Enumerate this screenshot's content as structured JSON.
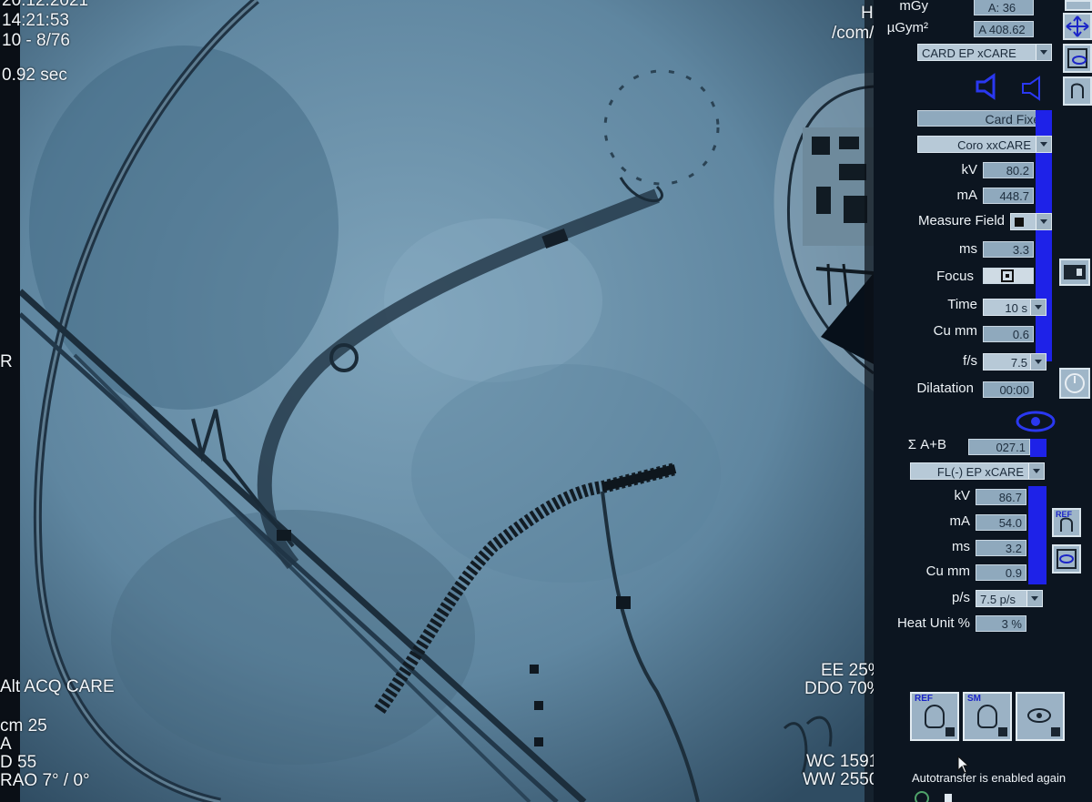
{
  "overlay": {
    "top_left": [
      "20.12.2021",
      "14:21:53",
      "10 - 8/76",
      "0.92 sec"
    ],
    "left_marker": "R",
    "bottom_left": [
      "Alt ACQ CARE",
      "cm 25",
      "A",
      "D 55",
      "RAO 7° / 0°"
    ],
    "top_right": [
      "HFS",
      "/com/////"
    ],
    "bottom_right_ee": [
      "EE 25%",
      "DDO 70%"
    ],
    "bottom_right_wc": [
      "WC 1591",
      "WW 2550"
    ]
  },
  "panel": {
    "dose": [
      {
        "label": "mGy",
        "value": "A: 36"
      },
      {
        "label": "µGym²",
        "value": "A 408.62"
      }
    ],
    "program_select": "CARD EP xCARE",
    "acquisition": {
      "mode": "Card Fixed",
      "protocol_select": "Coro xxCARE",
      "rows": [
        {
          "label": "kV",
          "value": "80.2"
        },
        {
          "label": "mA",
          "value": "448.7"
        }
      ],
      "measure_field_label": "Measure Field",
      "ms": {
        "label": "ms",
        "value": "3.3"
      },
      "focus_label": "Focus",
      "time": {
        "label": "Time",
        "value": "10 s"
      },
      "cu": {
        "label": "Cu mm",
        "value": "0.6"
      },
      "fs": {
        "label": "f/s",
        "value": "7.5"
      },
      "dilatation": {
        "label": "Dilatation",
        "value": "00:00"
      }
    },
    "fluoro": {
      "sum": {
        "label": "Σ  A+B",
        "value": "027.1"
      },
      "protocol_select": "FL(-) EP xCARE",
      "rows": [
        {
          "label": "kV",
          "value": "86.7"
        },
        {
          "label": "mA",
          "value": "54.0"
        },
        {
          "label": "ms",
          "value": "3.2"
        },
        {
          "label": "Cu mm",
          "value": "0.9"
        }
      ],
      "ps": {
        "label": "p/s",
        "value": "7.5 p/s"
      },
      "heat": {
        "label": "Heat Unit %",
        "value": "3 %"
      }
    },
    "buttons": {
      "ref_tag": "REF",
      "sm_tag": "SM"
    },
    "status": "Autotransfer is enabled again"
  },
  "colors": {
    "accent_blue": "#1e22e8",
    "panel_bg": "#0c1520",
    "field_bg": "#8fa9bd"
  }
}
